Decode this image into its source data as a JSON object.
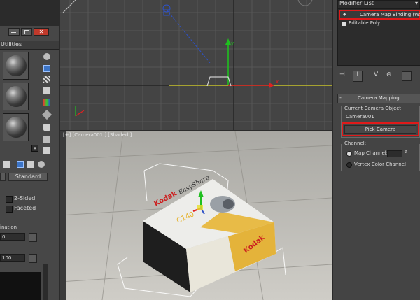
{
  "top_viewport": {
    "axis_x_label": "x",
    "axis_y_label": "y"
  },
  "persp_viewport": {
    "label": "[+] [Camera001 ] [Shaded ]",
    "box_brand": "Kodak",
    "box_brand_side": "Kodak",
    "box_product": "EasyShare",
    "box_model": "C140"
  },
  "material_editor": {
    "title": "Utilities",
    "std_button": "Standard",
    "two_sided_label": "2-Sided",
    "faceted_label": "Faceted",
    "section_label": "ination",
    "value_a": "0",
    "value_b": "100",
    "window_icons": [
      "minimize-icon",
      "restore-icon",
      "close-icon"
    ]
  },
  "command_panel": {
    "modifier_list_label": "Modifier List",
    "stack_items": [
      {
        "label": "Camera Map Binding (WS",
        "selected": true
      },
      {
        "label": "Editable Poly",
        "selected": false
      }
    ],
    "rollout_title": "Camera Mapping",
    "group_label": "Current Camera Object",
    "camera_name": "Camera001",
    "pick_camera_label": "Pick Camera",
    "channel_label": "Channel:",
    "map_channel_label": "Map Channel:",
    "map_channel_value": "1",
    "vertex_color_label": "Vertex Color Channel",
    "map_channel_selected": true
  },
  "colors": {
    "highlight": "#e01a1a",
    "viewport_bg": "#444444",
    "panel_bg": "#444444"
  }
}
